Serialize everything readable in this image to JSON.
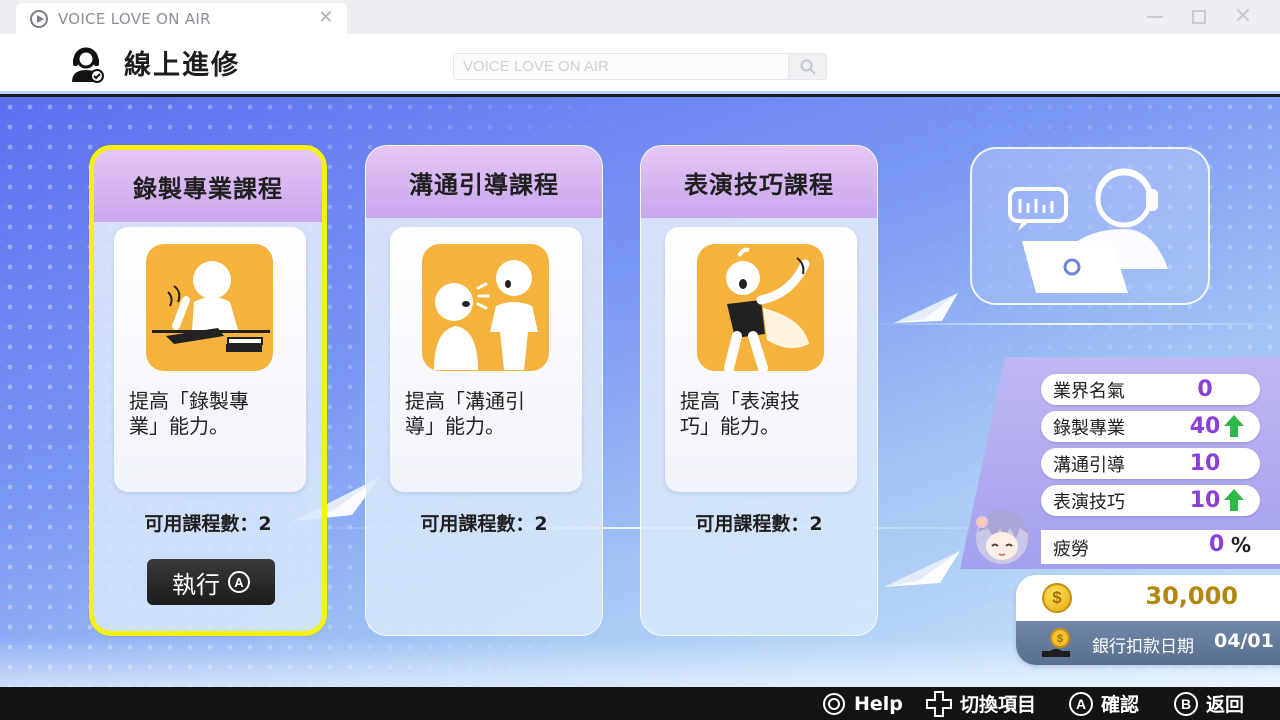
{
  "window": {
    "tab_title": "VOICE LOVE ON AIR",
    "tab_close": "✕",
    "min_icon": "minimize-icon",
    "max_icon": "maximize-icon",
    "close_symbol": "✕"
  },
  "header": {
    "title": "線上進修",
    "title_icon": "headset-person-icon",
    "search_placeholder": "VOICE LOVE ON AIR"
  },
  "courses": [
    {
      "title": "錄製專業課程",
      "desc": "提高「錄製專業」能力。",
      "count_label": "可用課程數：2",
      "icon": "writing-figure-icon",
      "selected": true
    },
    {
      "title": "溝通引導課程",
      "desc": "提高「溝通引導」能力。",
      "count_label": "可用課程數：2",
      "icon": "talking-figures-icon",
      "selected": false
    },
    {
      "title": "表演技巧課程",
      "desc": "提高「表演技巧」能力。",
      "count_label": "可用課程數：2",
      "icon": "performing-figure-icon",
      "selected": false
    }
  ],
  "execute_button": {
    "label": "執行",
    "badge": "A"
  },
  "stats": [
    {
      "label": "業界名氣",
      "value": "0",
      "arrow": false
    },
    {
      "label": "錄製專業",
      "value": "40",
      "arrow": true
    },
    {
      "label": "溝通引導",
      "value": "10",
      "arrow": false
    },
    {
      "label": "表演技巧",
      "value": "10",
      "arrow": true
    }
  ],
  "fatigue": {
    "label": "疲勞",
    "value": "0",
    "unit": "%"
  },
  "money": {
    "value": "30,000",
    "coin_symbol": "$"
  },
  "bank": {
    "label": "銀行扣款日期",
    "date": "04/01"
  },
  "footer": [
    {
      "badge": "⊛",
      "label": "Help",
      "icon": "stick-icon"
    },
    {
      "badge": "✚",
      "label": "切換項目",
      "icon": "dpad-icon"
    },
    {
      "badge": "A",
      "label": "確認",
      "icon": "a-button-icon"
    },
    {
      "badge": "B",
      "label": "返回",
      "icon": "b-button-icon"
    }
  ],
  "colors": {
    "accent_purple": "#8a3fd9",
    "selection_yellow": "#f5f20f",
    "up_arrow_green": "#2fb84a",
    "gold": "#b1870d"
  }
}
